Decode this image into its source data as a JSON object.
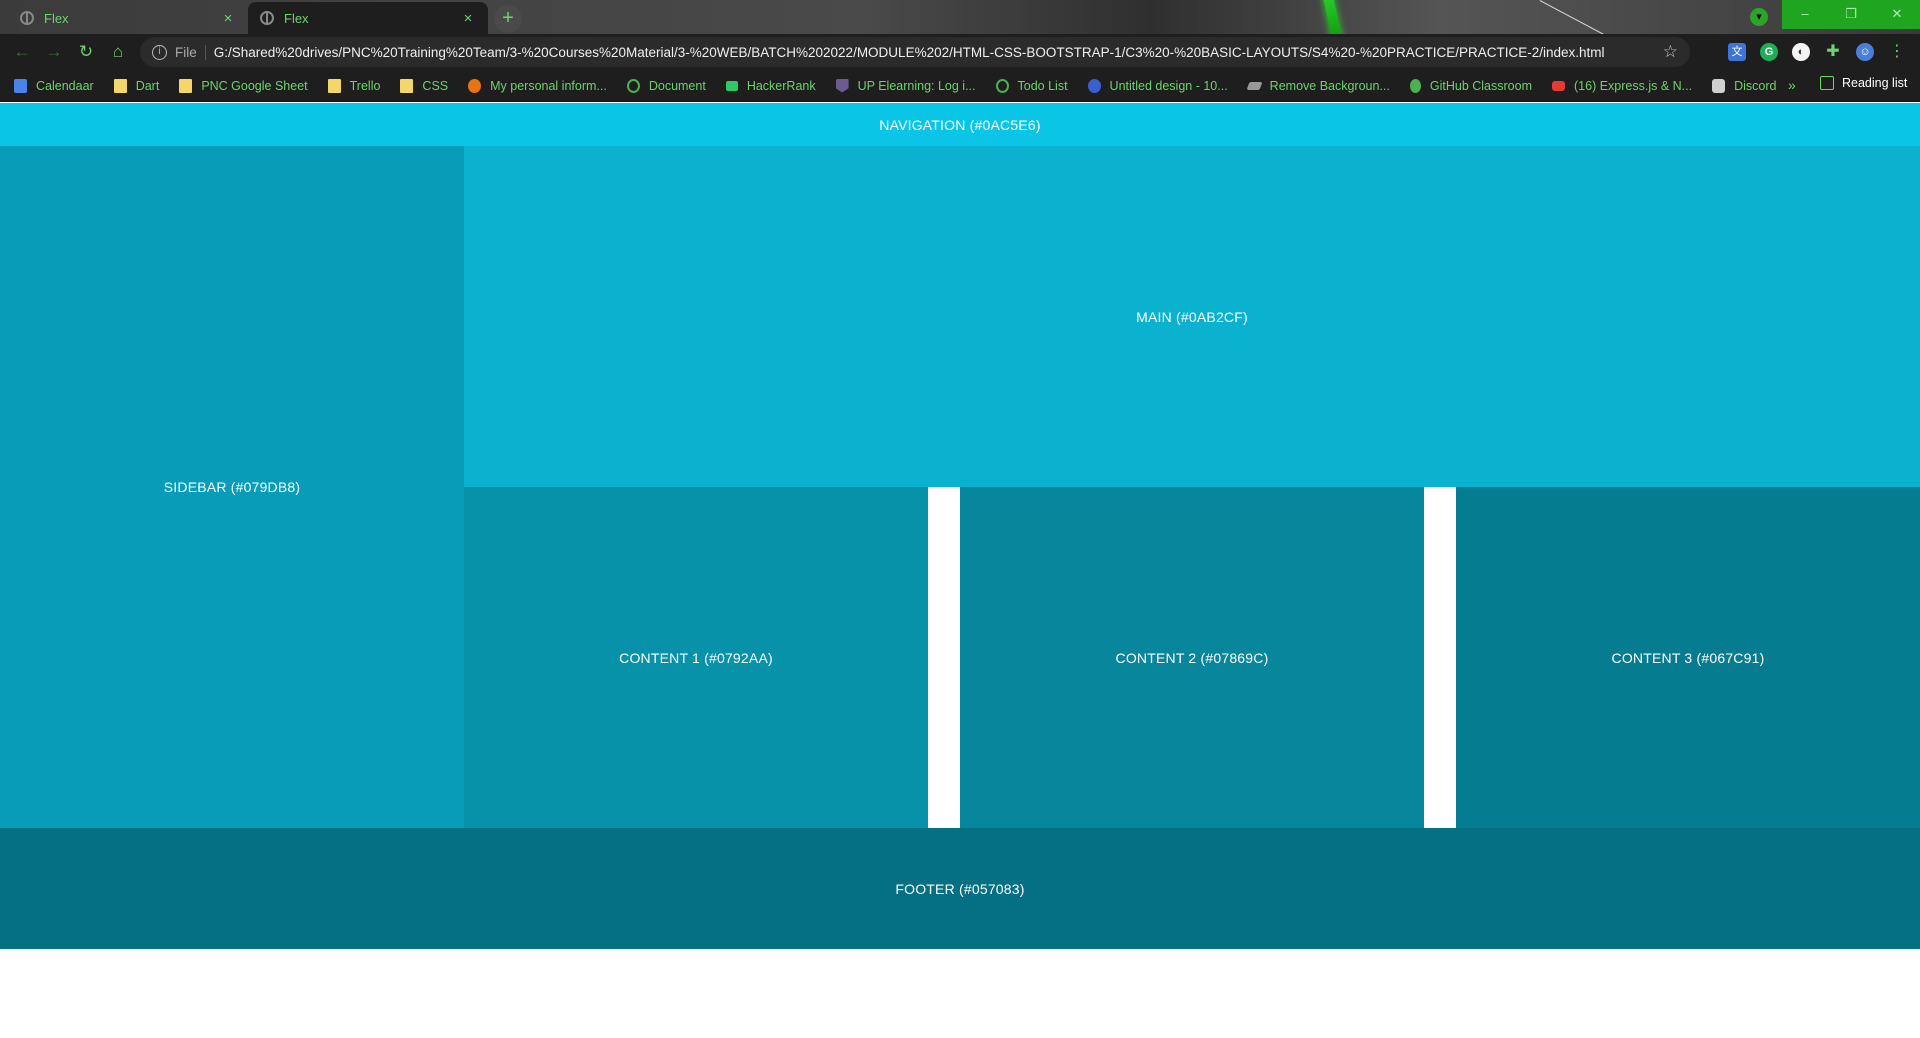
{
  "browser": {
    "tabs": [
      {
        "title": "Flex",
        "close": "×"
      },
      {
        "title": "Flex",
        "close": "×"
      }
    ],
    "new_tab": "+",
    "window_controls": {
      "minimize": "–",
      "maximize": "❐",
      "close": "✕"
    },
    "toolbar": {
      "back": "←",
      "forward": "→",
      "reload": "↻",
      "home": "⌂",
      "scheme": "File",
      "url": "G:/Shared%20drives/PNC%20Training%20Team/3-%20Courses%20Material/3-%20WEB/BATCH%202022/MODULE%202/HTML-CSS-BOOTSTRAP-1/C3%20-%20BASIC-LAYOUTS/S4%20-%20PRACTICE/PRACTICE-2/index.html",
      "bookmark_star": "☆"
    },
    "bookmarks": [
      {
        "label": "Calendaar",
        "icon": "calendar-icon"
      },
      {
        "label": "Dart",
        "icon": "folder-icon"
      },
      {
        "label": "PNC Google Sheet",
        "icon": "folder-icon"
      },
      {
        "label": "Trello",
        "icon": "folder-icon"
      },
      {
        "label": "CSS",
        "icon": "folder-icon"
      },
      {
        "label": "My personal inform...",
        "icon": "firefox-icon"
      },
      {
        "label": "Document",
        "icon": "globe-icon"
      },
      {
        "label": "HackerRank",
        "icon": "hackerrank-icon"
      },
      {
        "label": "UP Elearning: Log i...",
        "icon": "shield-icon"
      },
      {
        "label": "Todo List",
        "icon": "globe-icon"
      },
      {
        "label": "Untitled design - 10...",
        "icon": "canva-icon"
      },
      {
        "label": "Remove Backgroun...",
        "icon": "layers-icon"
      },
      {
        "label": "GitHub Classroom",
        "icon": "github-icon"
      },
      {
        "label": "(16) Express.js & N...",
        "icon": "youtube-icon"
      },
      {
        "label": "Discord",
        "icon": "discord-icon"
      }
    ],
    "bookmarks_more": "»",
    "reading_list": "Reading list"
  },
  "page": {
    "navigation": "NAVIGATION (#0AC5E6)",
    "sidebar": "SIDEBAR (#079DB8)",
    "main": "MAIN (#0AB2CF)",
    "content1": "CONTENT 1 (#0792AA)",
    "content2": "CONTENT 2 (#07869C)",
    "content3": "CONTENT 3 (#067C91)",
    "footer": "FOOTER (#057083)"
  },
  "colors": {
    "navigation": "#0AC5E6",
    "sidebar": "#079DB8",
    "main": "#0AB2CF",
    "content1": "#0792AA",
    "content2": "#07869C",
    "content3": "#067C91",
    "footer": "#057083"
  }
}
